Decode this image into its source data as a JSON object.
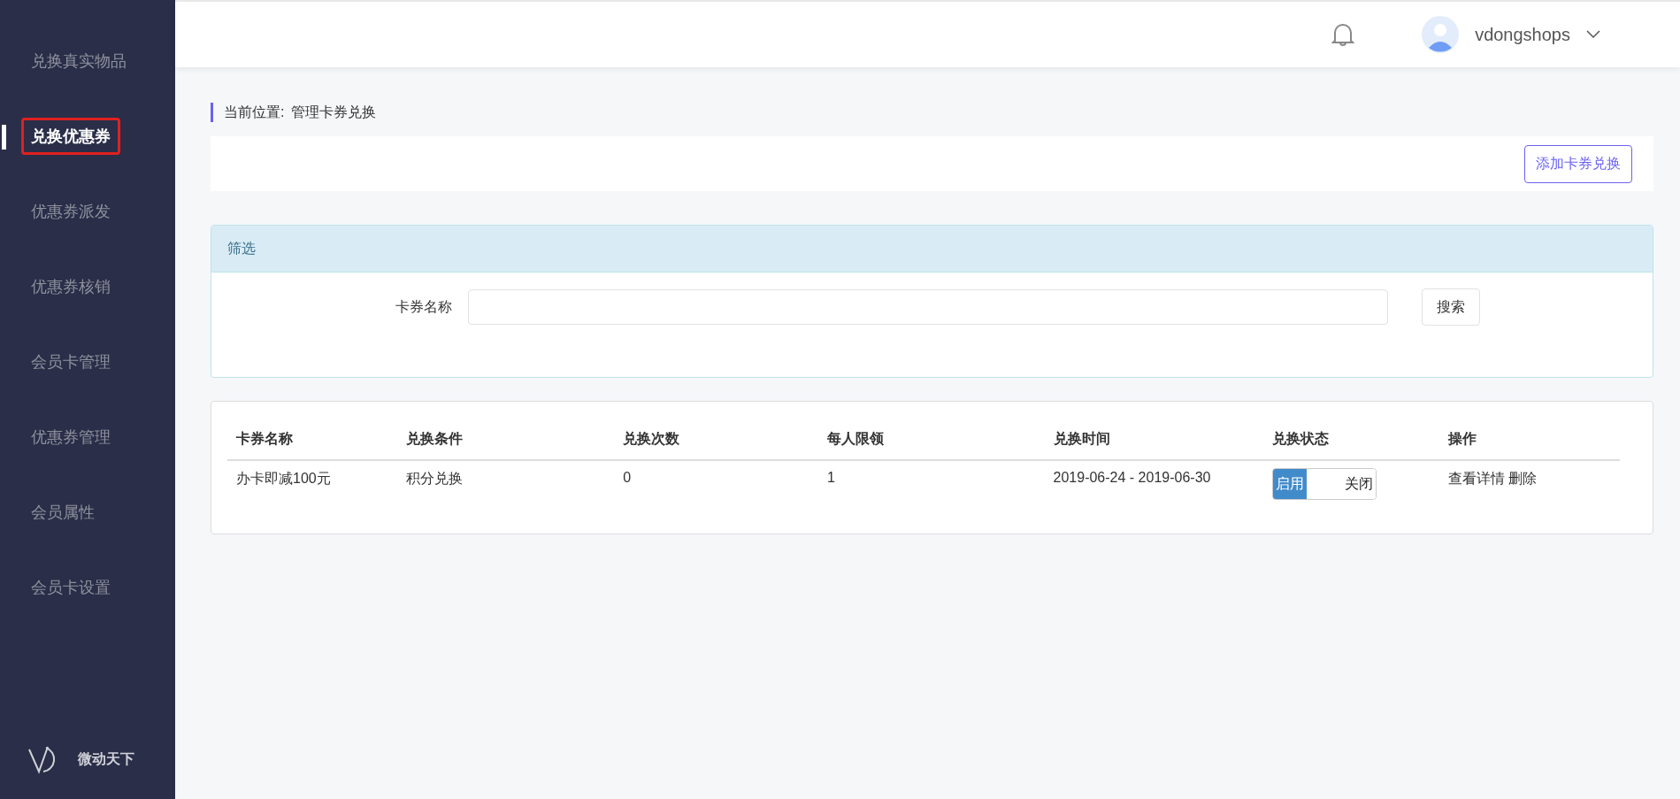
{
  "sidebar": {
    "items": [
      {
        "label": "兑换真实物品",
        "selected": false
      },
      {
        "label": "兑换优惠券",
        "selected": true
      },
      {
        "label": "优惠券派发",
        "selected": false
      },
      {
        "label": "优惠券核销",
        "selected": false
      },
      {
        "label": "会员卡管理",
        "selected": false
      },
      {
        "label": "优惠券管理",
        "selected": false
      },
      {
        "label": "会员属性",
        "selected": false
      },
      {
        "label": "会员卡设置",
        "selected": false
      }
    ],
    "brand": "微动天下"
  },
  "header": {
    "username": "vdongshops"
  },
  "breadcrumb": {
    "label": "当前位置:",
    "value": "管理卡券兑换"
  },
  "toolbar": {
    "add_button": "添加卡券兑换"
  },
  "filter": {
    "title": "筛选",
    "field_label": "卡券名称",
    "search_button": "搜索"
  },
  "table": {
    "columns": [
      "卡券名称",
      "兑换条件",
      "兑换次数",
      "每人限领",
      "兑换时间",
      "兑换状态",
      "操作"
    ],
    "rows": [
      {
        "name": "办卡即减100元",
        "condition": "积分兑换",
        "count": "0",
        "limit": "1",
        "time": "2019-06-24 - 2019-06-30",
        "status": {
          "on": true,
          "on_label": "启用",
          "off_label": "关闭"
        },
        "actions": [
          "查看详情",
          "删除"
        ]
      }
    ]
  }
}
